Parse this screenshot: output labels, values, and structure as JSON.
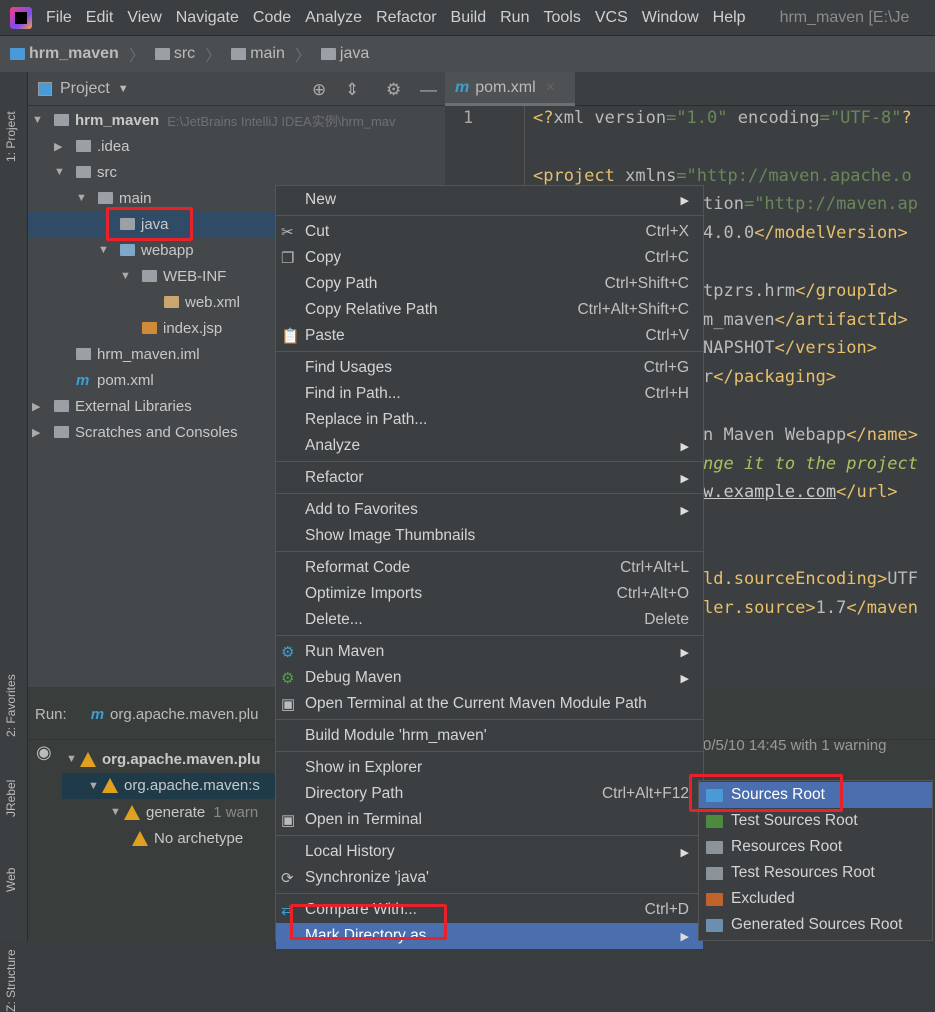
{
  "menubar": {
    "items": [
      "File",
      "Edit",
      "View",
      "Navigate",
      "Code",
      "Analyze",
      "Refactor",
      "Build",
      "Run",
      "Tools",
      "VCS",
      "Window",
      "Help"
    ],
    "title": "hrm_maven [E:\\Je"
  },
  "breadcrumb": [
    "hrm_maven",
    "src",
    "main",
    "java"
  ],
  "sidebar": {
    "project_tab": "1: Project",
    "favorites_tab": "2: Favorites",
    "jrebel_tab": "JRebel",
    "web_tab": "Web",
    "structure_tab": "Z: Structure"
  },
  "project": {
    "title": "Project",
    "tree": [
      {
        "label": "hrm_maven",
        "hint": "E:\\JetBrains IntelliJ IDEA实例\\hrm_mav",
        "depth": 0,
        "exp": "open",
        "icon": "module"
      },
      {
        "label": ".idea",
        "depth": 1,
        "exp": "closed",
        "icon": "folder"
      },
      {
        "label": "src",
        "depth": 1,
        "exp": "open",
        "icon": "folder"
      },
      {
        "label": "main",
        "depth": 2,
        "exp": "open",
        "icon": "folder"
      },
      {
        "label": "java",
        "depth": 3,
        "exp": "",
        "icon": "folder",
        "selected": true
      },
      {
        "label": "webapp",
        "depth": 3,
        "exp": "open",
        "icon": "web-folder"
      },
      {
        "label": "WEB-INF",
        "depth": 4,
        "exp": "open",
        "icon": "folder"
      },
      {
        "label": "web.xml",
        "depth": 5,
        "exp": "",
        "icon": "xml"
      },
      {
        "label": "index.jsp",
        "depth": 4,
        "exp": "",
        "icon": "jsp"
      },
      {
        "label": "hrm_maven.iml",
        "depth": 1,
        "exp": "",
        "icon": "iml"
      },
      {
        "label": "pom.xml",
        "depth": 1,
        "exp": "",
        "icon": "maven"
      },
      {
        "label": "External Libraries",
        "depth": 0,
        "exp": "closed",
        "icon": "library"
      },
      {
        "label": "Scratches and Consoles",
        "depth": 0,
        "exp": "closed",
        "icon": "scratch"
      }
    ]
  },
  "editor": {
    "tab": "pom.xml",
    "line_numbers": [
      "1"
    ],
    "lines": [
      [
        [
          "tag",
          "<?"
        ],
        [
          "attr",
          "xml version"
        ],
        [
          "str",
          "=\"1.0\""
        ],
        [
          "attr",
          " encoding"
        ],
        [
          "str",
          "=\"UTF-8\""
        ],
        [
          "tag",
          "?"
        ]
      ],
      [],
      [
        [
          "tag",
          "<project "
        ],
        [
          "attr",
          "xmlns"
        ],
        [
          "str",
          "=\"http://maven.apache.o"
        ]
      ],
      [
        [
          "attr",
          "tion"
        ],
        [
          "str",
          "=\"http://maven.ap"
        ]
      ],
      [
        [
          "attr",
          "4.0.0"
        ],
        [
          "tag",
          "</modelVersion>"
        ]
      ],
      [],
      [
        [
          "attr",
          "tpzrs.hrm"
        ],
        [
          "tag",
          "</groupId>"
        ]
      ],
      [
        [
          "attr",
          "m_maven"
        ],
        [
          "tag",
          "</artifactId>"
        ]
      ],
      [
        [
          "attr",
          "NAPSHOT"
        ],
        [
          "tag",
          "</version>"
        ]
      ],
      [
        [
          "attr",
          "r"
        ],
        [
          "tag",
          "</packaging>"
        ]
      ],
      [],
      [
        [
          "attr",
          "n Maven Webapp"
        ],
        [
          "tag",
          "</name>"
        ]
      ],
      [
        [
          "cm",
          "nge it to the project"
        ]
      ],
      [
        [
          "lnk",
          "w.example.com"
        ],
        [
          "tag",
          "</url>"
        ]
      ],
      [],
      [],
      [
        [
          "tag",
          "ld.sourceEncoding>"
        ],
        [
          "attr",
          "UTF"
        ]
      ],
      [
        [
          "tag",
          "ler.source>"
        ],
        [
          "attr",
          "1.7"
        ],
        [
          "tag",
          "</maven"
        ]
      ]
    ]
  },
  "run": {
    "label": "Run:",
    "tab": "org.apache.maven.plu",
    "status": "0/5/10 14:45 with 1 warning",
    "tree": [
      {
        "label": "org.apache.maven.plu",
        "bold": true
      },
      {
        "label": "org.apache.maven:s"
      },
      {
        "label": "generate",
        "hint": "1 warn"
      },
      {
        "label": "No archetype"
      }
    ]
  },
  "context_menu": [
    {
      "label": "New",
      "submenu": true
    },
    "sep",
    {
      "label": "Cut",
      "shortcut": "Ctrl+X",
      "icon": "scissors-icon"
    },
    {
      "label": "Copy",
      "shortcut": "Ctrl+C",
      "icon": "copy-icon"
    },
    {
      "label": "Copy Path",
      "shortcut": "Ctrl+Shift+C"
    },
    {
      "label": "Copy Relative Path",
      "shortcut": "Ctrl+Alt+Shift+C"
    },
    {
      "label": "Paste",
      "shortcut": "Ctrl+V",
      "icon": "paste-icon"
    },
    "sep",
    {
      "label": "Find Usages",
      "shortcut": "Ctrl+G"
    },
    {
      "label": "Find in Path...",
      "shortcut": "Ctrl+H"
    },
    {
      "label": "Replace in Path..."
    },
    {
      "label": "Analyze",
      "submenu": true
    },
    "sep",
    {
      "label": "Refactor",
      "submenu": true
    },
    "sep",
    {
      "label": "Add to Favorites",
      "submenu": true
    },
    {
      "label": "Show Image Thumbnails"
    },
    "sep",
    {
      "label": "Reformat Code",
      "shortcut": "Ctrl+Alt+L"
    },
    {
      "label": "Optimize Imports",
      "shortcut": "Ctrl+Alt+O"
    },
    {
      "label": "Delete...",
      "shortcut": "Delete"
    },
    "sep",
    {
      "label": "Run Maven",
      "submenu": true,
      "icon": "gear-blue-icon"
    },
    {
      "label": "Debug Maven",
      "submenu": true,
      "icon": "gear-green-icon"
    },
    {
      "label": "Open Terminal at the Current Maven Module Path",
      "icon": "terminal-icon"
    },
    "sep",
    {
      "label": "Build Module 'hrm_maven'"
    },
    "sep",
    {
      "label": "Show in Explorer"
    },
    {
      "label": "Directory Path",
      "shortcut": "Ctrl+Alt+F12"
    },
    {
      "label": "Open in Terminal",
      "icon": "terminal-icon"
    },
    "sep",
    {
      "label": "Local History",
      "submenu": true
    },
    {
      "label": "Synchronize 'java'",
      "icon": "sync-icon"
    },
    "sep",
    {
      "label": "Compare With...",
      "shortcut": "Ctrl+D",
      "icon": "compare-icon"
    },
    {
      "label": "Mark Directory as",
      "submenu": true,
      "selected": true
    }
  ],
  "submenu": [
    {
      "label": "Sources Root",
      "color": "#4a9ad8",
      "selected": true
    },
    {
      "label": "Test Sources Root",
      "color": "#4e8a3e"
    },
    {
      "label": "Resources Root",
      "color": "#8c9399"
    },
    {
      "label": "Test Resources Root",
      "color": "#8c9399"
    },
    {
      "label": "Excluded",
      "color": "#c0622c"
    },
    {
      "label": "Generated Sources Root",
      "color": "#6b8fae"
    }
  ],
  "colors": {
    "selection": "#4b6eaf",
    "highlight_box": "#e8212b"
  }
}
